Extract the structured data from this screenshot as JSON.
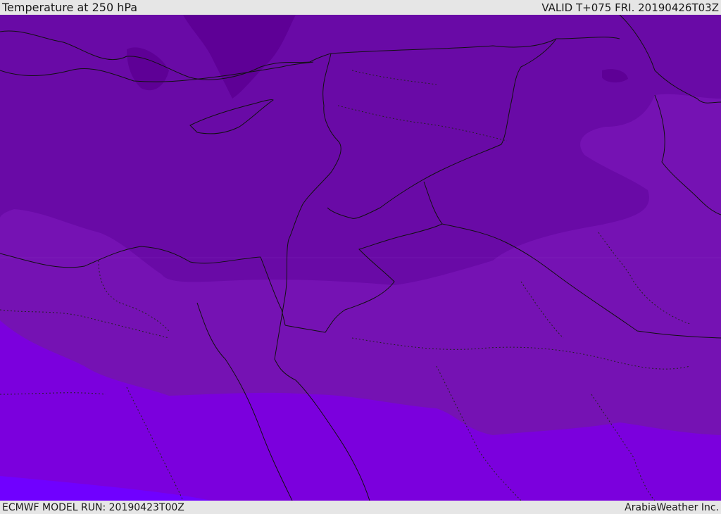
{
  "header": {
    "title": "Temperature at 250 hPa",
    "valid": "VALID T+075 FRI. 20190426T03Z"
  },
  "footer": {
    "model_run": "ECMWF MODEL RUN: 20190423T00Z",
    "credit": "ArabiaWeather Inc."
  },
  "colors": {
    "coldest_band": "#5e0096",
    "cold_band": "#690aa6",
    "mid_band": "#7512b3",
    "warm_band": "#7b00dd",
    "warmest_band": "#7000ff",
    "border_line": "#111111"
  }
}
